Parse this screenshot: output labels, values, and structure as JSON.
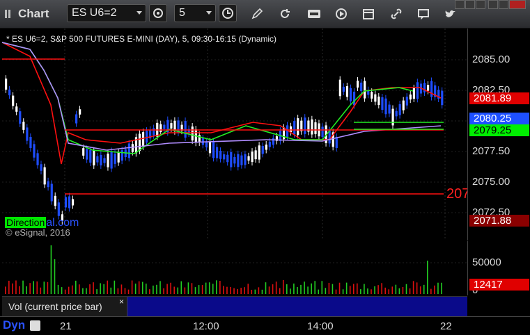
{
  "window": {
    "title": "Chart"
  },
  "toolbar": {
    "symbol_value": "ES U6=2",
    "interval_value": "5",
    "icons": [
      "symbol-settings-icon",
      "clock-icon",
      "pencil-icon",
      "refresh-icon",
      "get-icon",
      "play-icon",
      "link-icon",
      "comment-icon",
      "twitter-icon"
    ]
  },
  "chart": {
    "caption": "* ES U6=2, S&P 500 FUTURES E-MINI (DAY), 5, 09:30-16:15 (Dynamic)",
    "copyright": "© eSignal, 2016",
    "brand_part1": "Direction",
    "brand_part2": "al.com",
    "big_price_label": "207",
    "colors": {
      "up": "#ffffff",
      "down": "#1e4dff",
      "ma_red": "#ff1010",
      "ma_green": "#22ee22",
      "ma_purple": "#b08cff"
    }
  },
  "price_axis": {
    "ticks": [
      "2085.00",
      "2082.50",
      "2077.50",
      "2075.00",
      "2072.50"
    ],
    "tags": [
      {
        "name": "price-tag-2081",
        "text": "2081.89",
        "bg": "#e00000",
        "fg": "#ffffff"
      },
      {
        "name": "price-tag-2080",
        "text": "2080.25",
        "bg": "#1e50ff",
        "fg": "#ffffff"
      },
      {
        "name": "price-tag-2079",
        "text": "2079.25",
        "bg": "#00ee00",
        "fg": "#000000"
      },
      {
        "name": "price-tag-2071",
        "text": "2071.88",
        "bg": "#8a0000",
        "fg": "#ffffff"
      }
    ]
  },
  "volume": {
    "panel_label": "Vol (current price bar)",
    "close_glyph": "×",
    "ticks": [
      "50000",
      "0"
    ],
    "current_tag": "12417"
  },
  "time_axis": {
    "labels": [
      "21",
      "12:00",
      "14:00",
      "22"
    ],
    "dyn_label": "Dyn"
  }
}
